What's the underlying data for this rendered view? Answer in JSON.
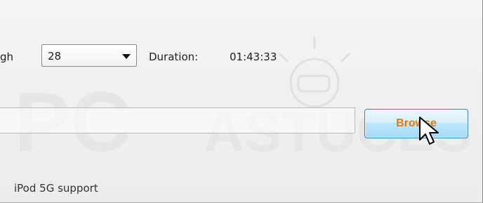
{
  "bitrate": {
    "label_fragment": "gh"
  },
  "combo": {
    "value": "28"
  },
  "duration": {
    "label": "Duration:",
    "value": "01:43:33"
  },
  "file_path": {
    "value": ""
  },
  "browse_button": {
    "label": "Browse"
  },
  "status": {
    "text": "iPod 5G support"
  },
  "colors": {
    "browse_text": "#e07a10",
    "button_border": "#3c7fb1"
  },
  "icons": {
    "combo_arrow": "chevron-down-icon",
    "cursor": "mouse-pointer-icon"
  }
}
